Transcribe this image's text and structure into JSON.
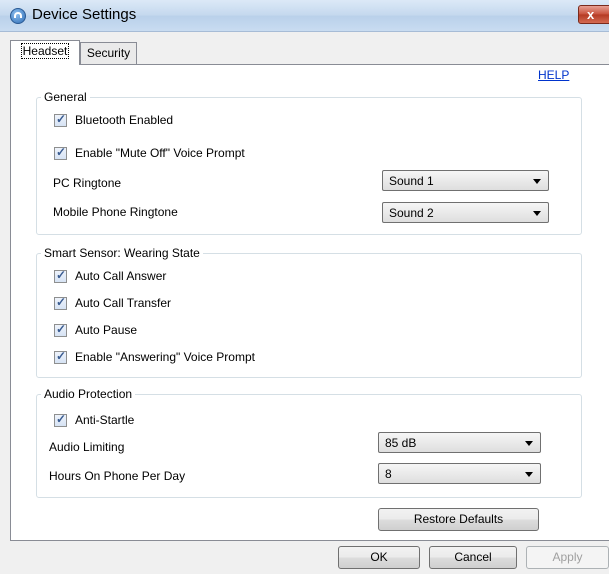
{
  "window": {
    "title": "Device Settings",
    "close_label": "x"
  },
  "tabs": [
    {
      "label": "Headset"
    },
    {
      "label": "Security"
    }
  ],
  "help_link": "HELP",
  "general": {
    "legend": "General",
    "bluetooth_label": "Bluetooth Enabled",
    "bluetooth_checked": true,
    "mute_off_label": "Enable \"Mute Off\" Voice Prompt",
    "mute_off_checked": true,
    "pc_ringtone_label": "PC Ringtone",
    "pc_ringtone_value": "Sound 1",
    "mobile_ringtone_label": "Mobile Phone Ringtone",
    "mobile_ringtone_value": "Sound 2"
  },
  "smart_sensor": {
    "legend": "Smart Sensor: Wearing State",
    "items": [
      {
        "label": "Auto Call Answer",
        "checked": true
      },
      {
        "label": "Auto Call Transfer",
        "checked": true
      },
      {
        "label": "Auto Pause",
        "checked": true
      },
      {
        "label": "Enable \"Answering\" Voice Prompt",
        "checked": true
      }
    ]
  },
  "audio_protection": {
    "legend": "Audio Protection",
    "anti_startle_label": "Anti-Startle",
    "anti_startle_checked": true,
    "audio_limiting_label": "Audio Limiting",
    "audio_limiting_value": "85 dB",
    "hours_label": "Hours On Phone Per Day",
    "hours_value": "8"
  },
  "buttons": {
    "restore": "Restore Defaults",
    "ok": "OK",
    "cancel": "Cancel",
    "apply": "Apply"
  }
}
